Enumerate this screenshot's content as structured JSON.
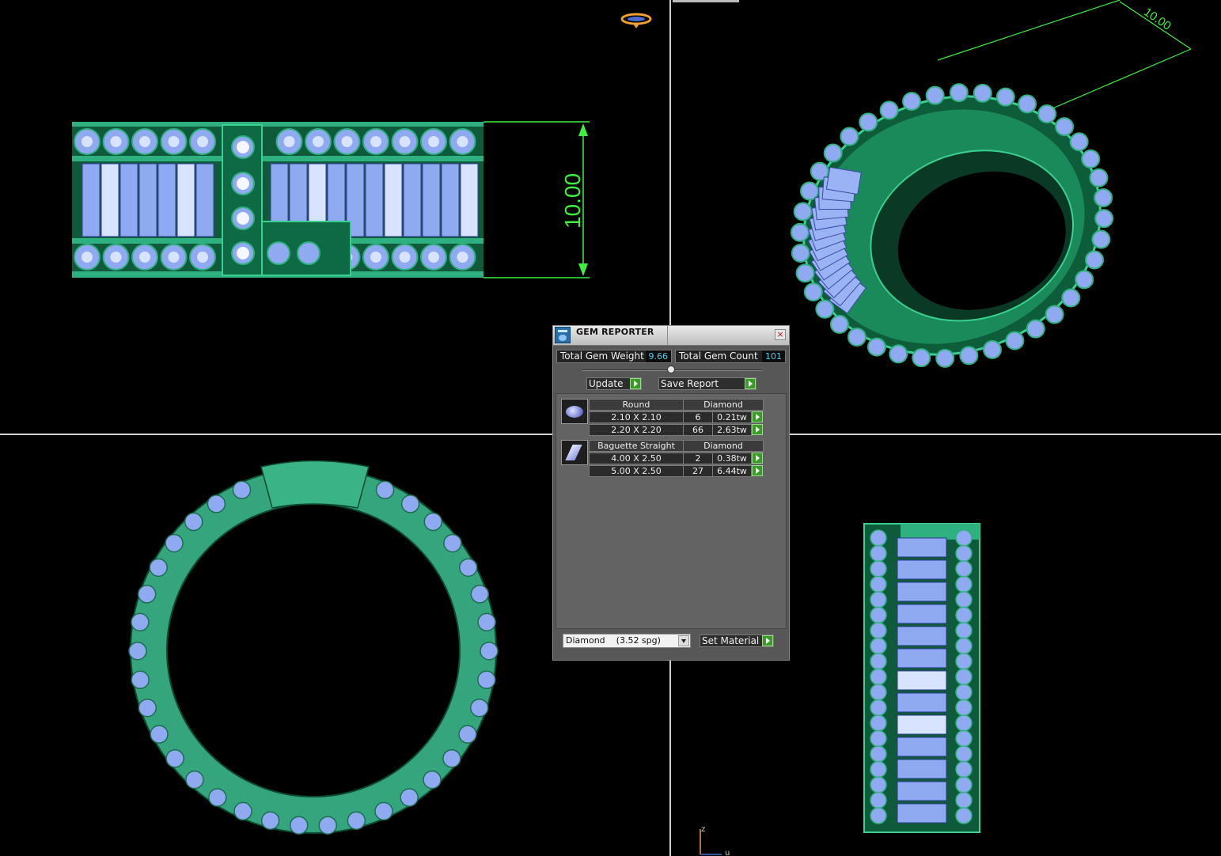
{
  "dimensions": {
    "height_label": "10.00",
    "iso_label": "10.00"
  },
  "gem_reporter": {
    "title": "GEM REPORTER",
    "close_glyph": "×",
    "total_gem_weight_label": "Total Gem Weight",
    "total_gem_weight": "9.66",
    "total_gem_count_label": "Total Gem Count",
    "total_gem_count": "101",
    "update_label": "Update",
    "save_report_label": "Save Report",
    "groups": [
      {
        "shape": "Round",
        "material": "Diamond",
        "icon": "round-gem-icon",
        "rows": [
          {
            "size": "2.10 X 2.10",
            "count": "6",
            "weight": "0.21tw"
          },
          {
            "size": "2.20 X 2.20",
            "count": "66",
            "weight": "2.63tw"
          }
        ]
      },
      {
        "shape": "Baguette Straight",
        "material": "Diamond",
        "icon": "baguette-gem-icon",
        "rows": [
          {
            "size": "4.00 X 2.50",
            "count": "2",
            "weight": "0.38tw"
          },
          {
            "size": "5.00 X 2.50",
            "count": "27",
            "weight": "6.44tw"
          }
        ]
      }
    ],
    "material_select": "Diamond    (3.52 spg)",
    "set_material_label": "Set Material"
  },
  "axis": {
    "z": "z",
    "u": "u"
  },
  "colors": {
    "metal": "#2fa67a",
    "metal_dark": "#0c4a30",
    "gem": "#8faaf0",
    "gem_light": "#d7e3ff",
    "dimension": "#3cf03c"
  }
}
